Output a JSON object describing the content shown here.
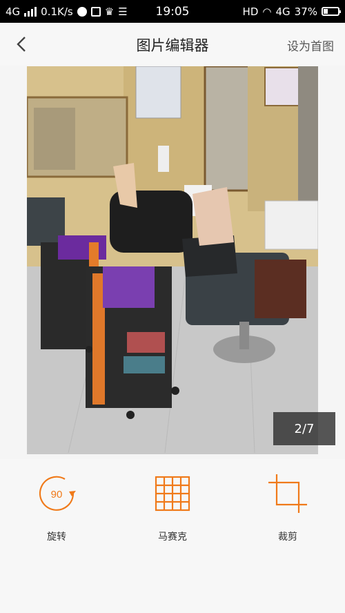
{
  "status_bar": {
    "network_left": "4G",
    "speed": "0.1K/s",
    "time": "19:05",
    "hd": "HD",
    "network_right": "4G",
    "battery": "37%"
  },
  "header": {
    "title": "图片编辑器",
    "set_home": "设为首图"
  },
  "photo": {
    "counter": "2/7"
  },
  "tools": {
    "rotate_label": "旋转",
    "rotate_badge": "90",
    "mosaic_label": "马赛克",
    "crop_label": "裁剪"
  },
  "colors": {
    "accent": "#f07a1a",
    "status_bg": "#000000"
  }
}
